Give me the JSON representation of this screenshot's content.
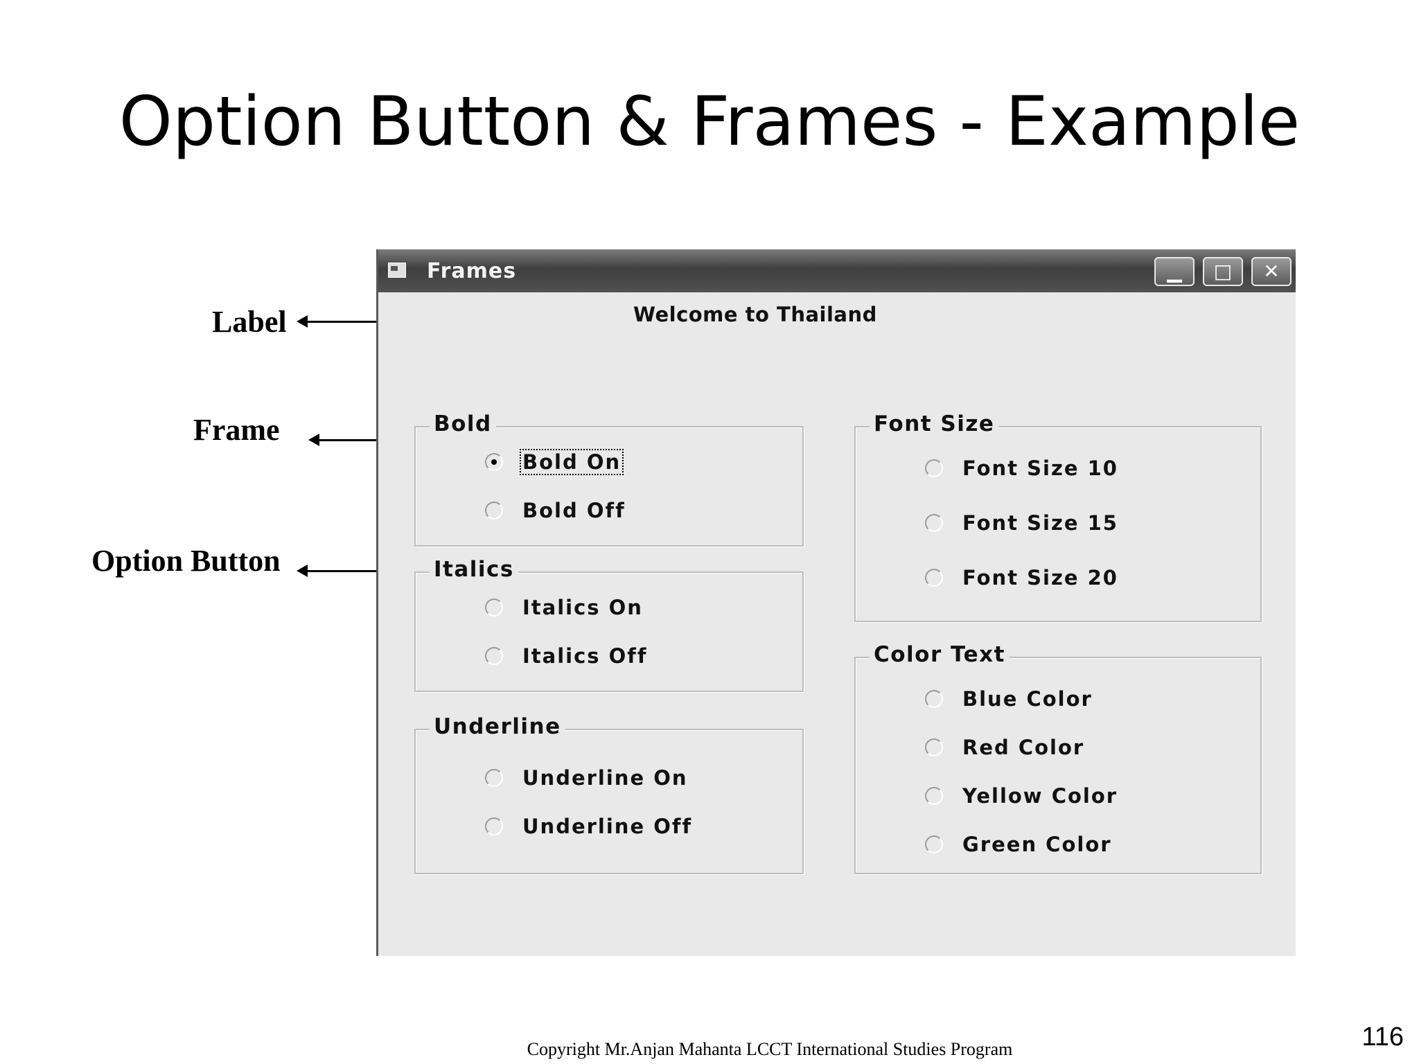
{
  "slide": {
    "title": "Option Button & Frames - Example",
    "page_number": "116",
    "copyright": "Copyright Mr.Anjan Mahanta LCCT International Studies Program"
  },
  "callouts": {
    "label": "Label",
    "frame": "Frame",
    "option_button": "Option Button"
  },
  "window": {
    "title": "Frames",
    "minimize_glyph": "▁",
    "maximize_glyph": "□",
    "close_glyph": "✕",
    "welcome_label": "Welcome to Thailand"
  },
  "frames": {
    "bold": {
      "legend": "Bold",
      "options": [
        {
          "label": "Bold On",
          "checked": true
        },
        {
          "label": "Bold Off",
          "checked": false
        }
      ]
    },
    "italics": {
      "legend": "Italics",
      "options": [
        {
          "label": "Italics On",
          "checked": false
        },
        {
          "label": "Italics Off",
          "checked": false
        }
      ]
    },
    "underline": {
      "legend": "Underline",
      "options": [
        {
          "label": "Underline On",
          "checked": false
        },
        {
          "label": "Underline Off",
          "checked": false
        }
      ]
    },
    "font_size": {
      "legend": "Font Size",
      "options": [
        {
          "label": "Font Size 10",
          "checked": false
        },
        {
          "label": "Font Size 15",
          "checked": false
        },
        {
          "label": "Font Size 20",
          "checked": false
        }
      ]
    },
    "color_text": {
      "legend": "Color Text",
      "options": [
        {
          "label": "Blue Color",
          "checked": false
        },
        {
          "label": "Red Color",
          "checked": false
        },
        {
          "label": "Yellow Color",
          "checked": false
        },
        {
          "label": "Green Color",
          "checked": false
        }
      ]
    }
  }
}
